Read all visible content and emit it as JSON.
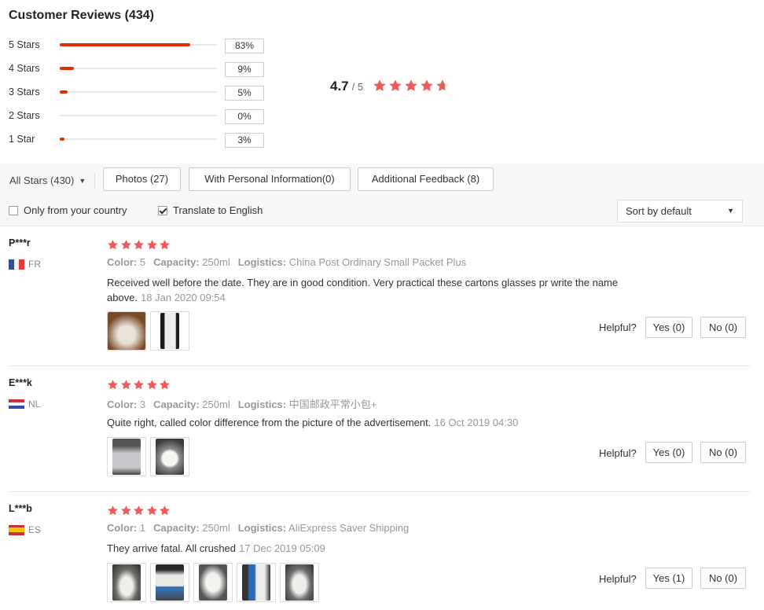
{
  "header": {
    "title": "Customer Reviews",
    "count": "(434)"
  },
  "distribution": [
    {
      "label": "5 Stars",
      "percent": "83%",
      "fraction": 0.83
    },
    {
      "label": "4 Stars",
      "percent": "9%",
      "fraction": 0.09
    },
    {
      "label": "3 Stars",
      "percent": "5%",
      "fraction": 0.05
    },
    {
      "label": "2 Stars",
      "percent": "0%",
      "fraction": 0.0
    },
    {
      "label": "1 Star",
      "percent": "3%",
      "fraction": 0.03
    }
  ],
  "average": {
    "score": "4.7",
    "max": "/ 5",
    "rating": 4.7
  },
  "filters": {
    "all_stars": "All Stars (430)",
    "photos": "Photos (27)",
    "personal": "With Personal Information(0)",
    "additional": "Additional Feedback (8)",
    "only_country": "Only from your country",
    "only_country_checked": false,
    "translate": "Translate to English",
    "translate_checked": true,
    "sort": "Sort by default"
  },
  "labels": {
    "color": "Color:",
    "capacity": "Capacity:",
    "logistics": "Logistics:",
    "helpful": "Helpful?"
  },
  "colors": {
    "accent": "#e62e04",
    "star": "#f05959"
  },
  "reviews": [
    {
      "user": "P***r",
      "country": "FR",
      "flag": "fr-flag-icon",
      "stars": 5,
      "color": "5",
      "capacity": "250ml",
      "logistics": "China Post Ordinary Small Packet Plus",
      "text": "Received well before the date. They are in good condition. Very practical these cartons glasses pr write the name above.",
      "date": "18 Jan 2020 09:54",
      "photos": 2,
      "yes": "Yes (0)",
      "no": "No (0)"
    },
    {
      "user": "E***k",
      "country": "NL",
      "flag": "nl-flag-icon",
      "stars": 5,
      "color": "3",
      "capacity": "250ml",
      "logistics": "中国邮政平常小包+",
      "text": "Quite right, called color difference from the picture of the advertisement.",
      "date": "16 Oct 2019 04:30",
      "photos": 2,
      "yes": "Yes (0)",
      "no": "No (0)"
    },
    {
      "user": "L***b",
      "country": "ES",
      "flag": "es-flag-icon",
      "stars": 5,
      "color": "1",
      "capacity": "250ml",
      "logistics": "AliExpress Saver Shipping",
      "text": "They arrive fatal. All crushed",
      "date": "17 Dec 2019 05:09",
      "photos": 5,
      "yes": "Yes (1)",
      "no": "No (0)"
    }
  ]
}
